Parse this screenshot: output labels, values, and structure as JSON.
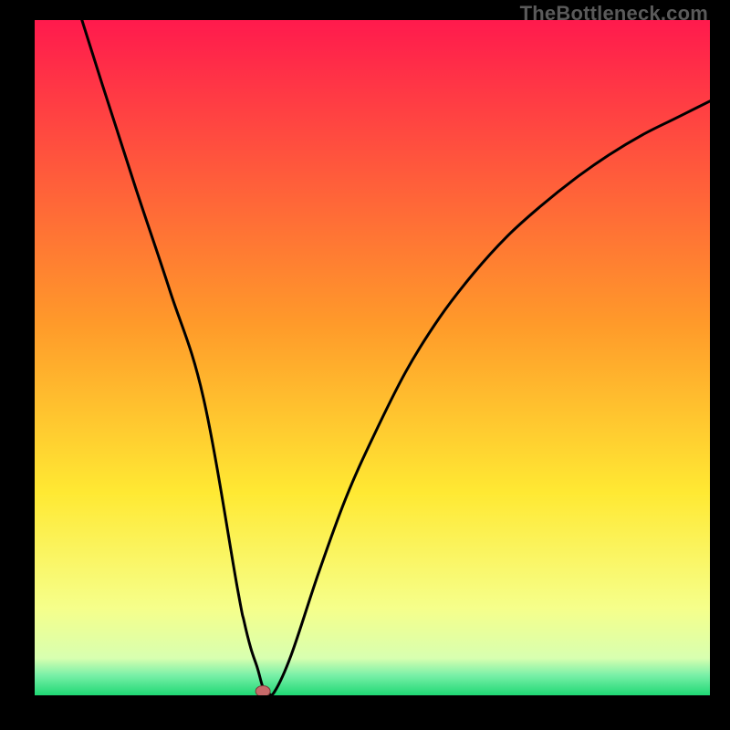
{
  "watermark": "TheBottleneck.com",
  "colors": {
    "gradient_top": "#ff1a4d",
    "gradient_mid1": "#ff8a2a",
    "gradient_mid2": "#ffe933",
    "gradient_band": "#f6ff8a",
    "gradient_bottom": "#26e27a",
    "curve": "#000000",
    "marker_fill": "#c76a6a",
    "marker_stroke": "#7a3a3a",
    "frame": "#000000"
  },
  "chart_data": {
    "type": "line",
    "title": "",
    "xlabel": "",
    "ylabel": "",
    "xlim": [
      0,
      100
    ],
    "ylim": [
      0,
      100
    ],
    "grid": false,
    "legend": null,
    "series": [
      {
        "name": "curve",
        "x": [
          7,
          10,
          15,
          20,
          25,
          30,
          31,
          32,
          33,
          33.8,
          34.5,
          35.5,
          38,
          42,
          46,
          50,
          55,
          60,
          65,
          70,
          75,
          80,
          85,
          90,
          95,
          100
        ],
        "y": [
          100,
          90.5,
          75,
          60,
          44,
          16,
          11,
          7,
          4,
          1.2,
          0.5,
          0.5,
          6,
          18,
          29,
          38,
          48,
          56,
          62.5,
          68,
          72.5,
          76.5,
          80,
          83,
          85.5,
          88
        ]
      }
    ],
    "annotations": [
      {
        "name": "min-marker",
        "x": 33.8,
        "y": 0.6
      }
    ],
    "background_gradient": [
      {
        "pos": 0.0,
        "color": "#ff1a4d"
      },
      {
        "pos": 0.45,
        "color": "#ff9a2a"
      },
      {
        "pos": 0.7,
        "color": "#ffe933"
      },
      {
        "pos": 0.87,
        "color": "#f6ff8a"
      },
      {
        "pos": 0.945,
        "color": "#d8ffb0"
      },
      {
        "pos": 0.97,
        "color": "#7af0a8"
      },
      {
        "pos": 1.0,
        "color": "#1fd874"
      }
    ]
  }
}
